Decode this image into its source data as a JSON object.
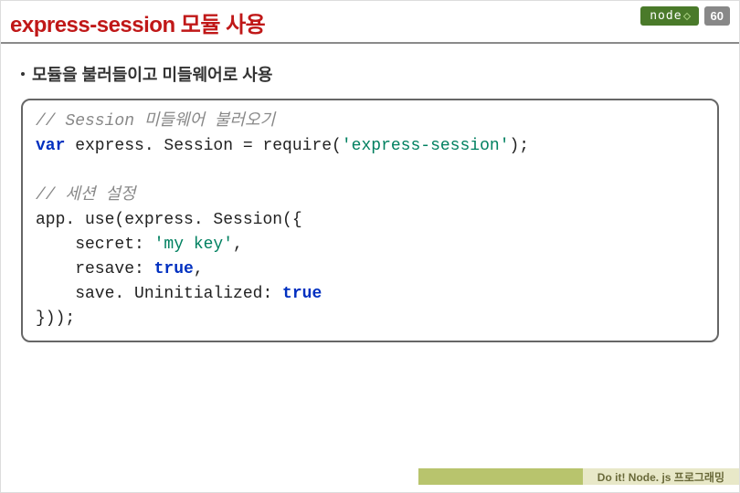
{
  "header": {
    "title": "express-session 모듈 사용",
    "node_label": "node",
    "page_number": "60"
  },
  "bullet": {
    "text": "모듈을 불러들이고 미들웨어로 사용"
  },
  "code": {
    "comment1": "// Session 미들웨어 불러오기",
    "line1_kw": "var",
    "line1_rest": " express. Session = require(",
    "line1_str": "'express-session'",
    "line1_end": ");",
    "comment2": "// 세션 설정",
    "line2": "app. use(express. Session({",
    "line3_a": "    secret: ",
    "line3_str": "'my key'",
    "line3_b": ",",
    "line4_a": "    resave: ",
    "line4_lit": "true",
    "line4_b": ",",
    "line5_a": "    save. Uninitialized: ",
    "line5_lit": "true",
    "line6": "}));"
  },
  "footer": {
    "text": "Do it! Node. js 프로그래밍"
  }
}
